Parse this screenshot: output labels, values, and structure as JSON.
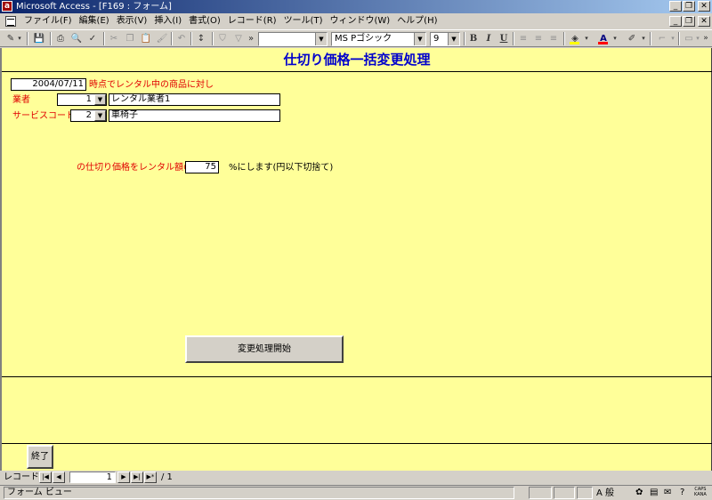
{
  "window": {
    "title": "Microsoft Access - [F169 : フォーム]",
    "app_icon": "access-icon"
  },
  "menu": {
    "items": [
      "ファイル(F)",
      "編集(E)",
      "表示(V)",
      "挿入(I)",
      "書式(O)",
      "レコード(R)",
      "ツール(T)",
      "ウィンドウ(W)",
      "ヘルプ(H)"
    ]
  },
  "toolbar": {
    "object_combo": "",
    "font_name": "MS Pゴシック",
    "font_size": "9",
    "bold": "B",
    "italic": "I",
    "underline": "U",
    "font_color": "#ff0000",
    "fill_color": "#ffff00"
  },
  "form": {
    "title": "仕切り価格一括変更処理",
    "date_value": "2004/07/11",
    "date_suffix": "時点でレンタル中の商品に対し",
    "vendor_label": "業者",
    "vendor_code": "1",
    "vendor_name": "レンタル業者1",
    "service_label": "サービスコード",
    "service_code": "2",
    "service_name": "車椅子",
    "price_prefix": "の仕切り価格をレンタル額の",
    "percent_value": "75",
    "price_suffix": "%にします(円以下切捨て)",
    "start_button": "変更処理開始",
    "exit_button": "終了",
    "background_color": "#ffff99",
    "label_color": "#e00000",
    "title_color": "#0000cc"
  },
  "record_nav": {
    "label": "レコード:",
    "current": "1",
    "total": "/ 1"
  },
  "status": {
    "text": "フォーム ビュー",
    "caps": "CAPS",
    "kana": "KANA",
    "ime": "A 般"
  }
}
